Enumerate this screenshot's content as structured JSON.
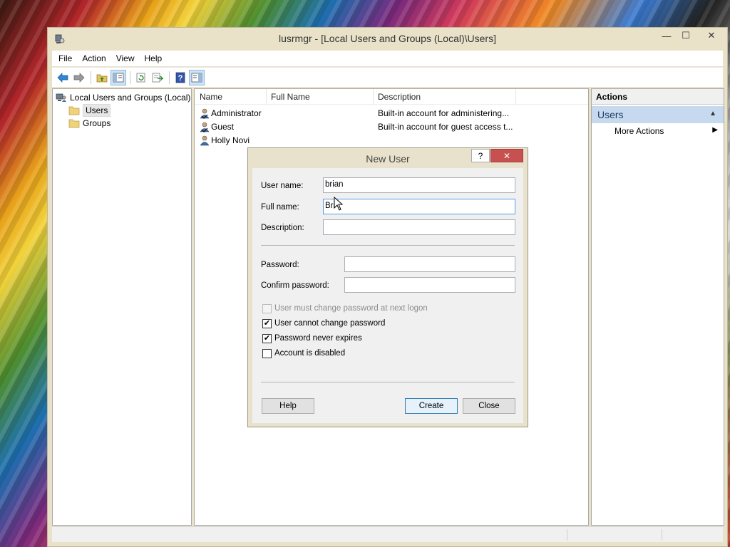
{
  "window": {
    "title": "lusrmgr - [Local Users and Groups (Local)\\Users]",
    "controls": {
      "minimize": "—",
      "maximize": "☐",
      "close": "✕"
    }
  },
  "menu": {
    "items": [
      "File",
      "Action",
      "View",
      "Help"
    ]
  },
  "toolbar": {
    "icons": [
      "back-arrow-icon",
      "forward-arrow-icon",
      "up-folder-icon",
      "show-hide-console-tree-icon",
      "refresh-icon",
      "export-list-icon",
      "help-icon",
      "show-hide-action-pane-icon"
    ]
  },
  "tree": {
    "root": "Local Users and Groups (Local)",
    "users": "Users",
    "groups": "Groups"
  },
  "list": {
    "columns": {
      "name": "Name",
      "full_name": "Full Name",
      "description": "Description"
    },
    "rows": [
      {
        "name": "Administrator",
        "full_name": "",
        "description": "Built-in account for administering..."
      },
      {
        "name": "Guest",
        "full_name": "",
        "description": "Built-in account for guest access t..."
      },
      {
        "name": "Holly Novi",
        "full_name": "",
        "description": ""
      }
    ]
  },
  "actions": {
    "header": "Actions",
    "group": "Users",
    "item": "More Actions"
  },
  "dialog": {
    "title": "New User",
    "help_glyph": "?",
    "close_glyph": "✕",
    "username_label": "User name:",
    "username_value": "brian",
    "fullname_label": "Full name:",
    "fullname_value": "Bri",
    "description_label": "Description:",
    "description_value": "",
    "password_label": "Password:",
    "password_value": "",
    "confirm_label": "Confirm password:",
    "confirm_value": "",
    "checks": {
      "must_change": {
        "label": "User must change password at next logon",
        "checked": false,
        "disabled": true
      },
      "cannot_change": {
        "label": "User cannot change password",
        "checked": true,
        "disabled": false
      },
      "never_expires": {
        "label": "Password never expires",
        "checked": true,
        "disabled": false
      },
      "disabled": {
        "label": "Account is disabled",
        "checked": false,
        "disabled": false
      }
    },
    "check_mark": "✔",
    "buttons": {
      "help": "Help",
      "create": "Create",
      "close": "Close"
    }
  }
}
